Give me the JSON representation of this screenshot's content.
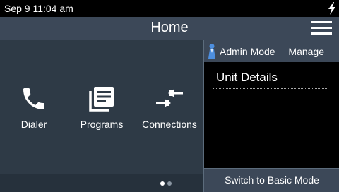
{
  "status_bar": {
    "time": "Sep 9 11:04 am",
    "icon": "charging-bolt-icon"
  },
  "header": {
    "title": "Home",
    "menu_icon": "hamburger-menu-icon"
  },
  "apps": [
    {
      "label": "Dialer",
      "icon": "phone-icon"
    },
    {
      "label": "Programs",
      "icon": "programs-list-icon"
    },
    {
      "label": "Connections",
      "icon": "connections-arrows-icon"
    }
  ],
  "pager": {
    "pages": 2,
    "current": 1
  },
  "admin_panel": {
    "mode_label": "Admin Mode",
    "manage_label": "Manage",
    "items": [
      {
        "label": "Unit Details"
      }
    ],
    "footer_label": "Switch to Basic Mode"
  },
  "colors": {
    "header_bg": "#3c4858",
    "home_bg": "#2e3a46",
    "status_bg": "#000000",
    "dot_active": "#ffffff",
    "dot_inactive": "#8a96a2"
  }
}
